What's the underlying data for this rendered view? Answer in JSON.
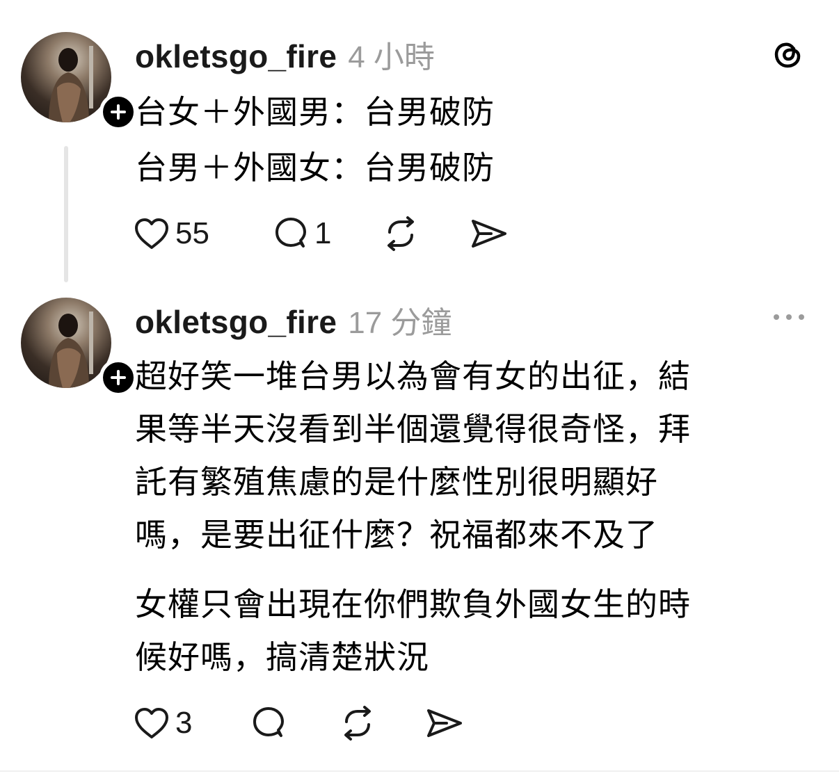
{
  "posts": [
    {
      "username": "okletsgo_fire",
      "time": "4 小時",
      "lines": [
        "台女＋外國男：台男破防",
        "台男＋外國女：台男破防"
      ],
      "likes": "55",
      "replies": "1"
    },
    {
      "username": "okletsgo_fire",
      "time": "17 分鐘",
      "lines": [
        "超好笑一堆台男以為會有女的出征，結",
        "果等半天沒看到半個還覺得很奇怪，拜",
        "託有繁殖焦慮的是什麼性別很明顯好",
        "嗎，是要出征什麼？祝福都來不及了",
        "女權只會出現在你們欺負外國女生的時",
        "候好嗎，搞清楚狀況"
      ],
      "likes": "3",
      "replies": ""
    }
  ],
  "icons": {
    "brand": "threads-icon",
    "more": "more-icon",
    "like": "heart-icon",
    "reply": "comment-icon",
    "repost": "repost-icon",
    "share": "share-icon",
    "follow": "plus-icon"
  },
  "colors": {
    "text": "#000000",
    "muted": "#9b9b9b",
    "thread_line": "#e5e5e5"
  }
}
